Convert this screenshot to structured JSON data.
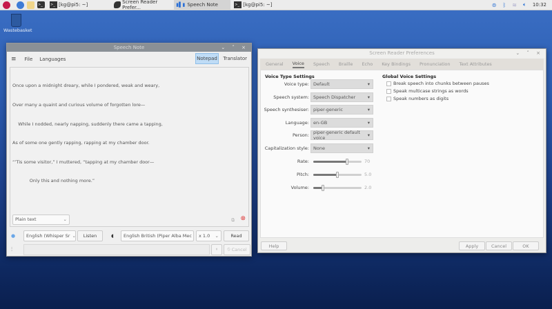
{
  "taskbar": {
    "tasks": [
      {
        "label": "[kg@pi5: ~]",
        "icon": "terminal-icon"
      },
      {
        "label": "Screen Reader Prefer...",
        "icon": "orca-icon"
      },
      {
        "label": "Speech Note",
        "icon": "speech-note-icon",
        "active": true
      },
      {
        "label": "[kg@pi5: ~]",
        "icon": "terminal-icon"
      }
    ],
    "clock": "10:32"
  },
  "desktop": {
    "wastebasket": "Wastebasket"
  },
  "speech_note": {
    "title": "Speech Note",
    "menu": [
      "File",
      "Languages"
    ],
    "tabs": [
      "Notepad",
      "Translator"
    ],
    "active_tab": "Notepad",
    "text_lines": [
      "Once upon a midnight dreary, while I pondered, weak and weary,",
      "Over many a quaint and curious volume of forgotten lore—",
      "    While I nodded, nearly napping, suddenly there came a tapping,",
      "As of some one gently rapping, rapping at my chamber door.",
      "“’Tis some visitor,” I muttered, “tapping at my chamber door—",
      "            Only this and nothing more.”"
    ],
    "format": "Plain text",
    "stt_model": "English (Whisper Sr",
    "listen": "Listen",
    "tts_model": "English British (Piper Alba Mec",
    "speed": "x 1.0",
    "read": "Read",
    "cancel": "Cancel"
  },
  "orca": {
    "title": "Screen Reader Preferences",
    "tabs": [
      "General",
      "Voice",
      "Speech",
      "Braille",
      "Echo",
      "Key Bindings",
      "Pronunciation",
      "Text Attributes"
    ],
    "active_tab": "Voice",
    "voice_type_heading": "Voice Type Settings",
    "fields": [
      {
        "label": "Voice type:",
        "value": "Default"
      },
      {
        "label": "Speech system:",
        "value": "Speech Dispatcher"
      },
      {
        "label": "Speech synthesiser:",
        "value": "piper-generic"
      },
      {
        "label": "Language:",
        "value": "en-GB"
      },
      {
        "label": "Person:",
        "value": "piper-generic default voice"
      },
      {
        "label": "Capitalization style:",
        "value": "None"
      }
    ],
    "sliders": [
      {
        "label": "Rate:",
        "value": "70",
        "fraction": 0.7
      },
      {
        "label": "Pitch:",
        "value": "5.0",
        "fraction": 0.5
      },
      {
        "label": "Volume:",
        "value": "2.0",
        "fraction": 0.2
      }
    ],
    "global_heading": "Global Voice Settings",
    "checkboxes": [
      {
        "label": "Break speech into chunks between pauses",
        "checked": false
      },
      {
        "label": "Speak multicase strings as words",
        "checked": false
      },
      {
        "label": "Speak numbers as digits",
        "checked": false
      }
    ],
    "buttons": {
      "help": "Help",
      "apply": "Apply",
      "cancel": "Cancel",
      "ok": "OK"
    }
  }
}
